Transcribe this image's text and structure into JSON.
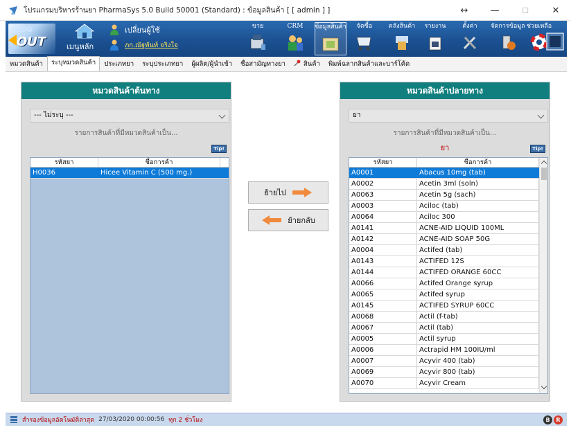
{
  "window": {
    "title": "โปรแกรมบริหารร้านยา PharmaSys 5.0 Build 50001 (Standard) : ข้อมูลสินค้า  [ [ admin ] ]",
    "minimize": "—",
    "restore": "☐",
    "close": "✕",
    "extra": "↔"
  },
  "toolbar": {
    "logout_top": "LOG",
    "logout_bottom": "OUT",
    "home_label": "เมนูหลัก",
    "change_user_label": "เปลี่ยนผู้ใช้",
    "user_name": "ภก.ณัฐพันท์ จริงใจ",
    "buttons": [
      {
        "label": "ขาย",
        "icon": "sale-icon"
      },
      {
        "label": "CRM",
        "icon": "crm-icon"
      },
      {
        "label": "ข้อมูลสินค้า",
        "icon": "product-data-icon",
        "active": true
      },
      {
        "label": "จัดซื้อ",
        "icon": "purchase-icon"
      },
      {
        "label": "คลังสินค้า",
        "icon": "warehouse-icon"
      },
      {
        "label": "รายงาน",
        "icon": "report-icon"
      },
      {
        "label": "ตั้งค่า",
        "icon": "settings-icon"
      },
      {
        "label": "จัดการข้อมูล",
        "icon": "data-management-icon"
      },
      {
        "label": "ช่วยเหลือ",
        "icon": "help-icon"
      },
      {
        "label": "",
        "icon": "exit-icon"
      }
    ]
  },
  "tabs": [
    {
      "label": "หมวดสินค้า"
    },
    {
      "label": "ระบุหมวดสินค้า",
      "active": true
    },
    {
      "label": "ประเภทยา"
    },
    {
      "label": "ระบุประเภทยา"
    },
    {
      "label": "ผู้ผลิต/ผู้นำเข้า"
    },
    {
      "label": "ชื่อสามัญทางยา"
    },
    {
      "label": "สินค้า",
      "pin": true
    },
    {
      "label": "พิมพ์ฉลากสินค้าและบาร์โค้ด"
    }
  ],
  "source": {
    "title": "หมวดสินค้าต้นทาง",
    "select_value": "--- ไม่ระบุ ---",
    "hint": "รายการสินค้าที่มีหมวดสินค้าเป็น...",
    "tip": "Tip!",
    "col_code": "รหัสยา",
    "col_name": "ชื่อการค้า",
    "rows": [
      {
        "code": "H0036",
        "name": "Hicee Vitamin C (500 mg.)",
        "selected": true
      }
    ]
  },
  "target": {
    "title": "หมวดสินค้าปลายทาง",
    "select_value": "ยา",
    "hint": "รายการสินค้าที่มีหมวดสินค้าเป็น...",
    "category_label": "ยา",
    "tip": "Tip!",
    "col_code": "รหัสยา",
    "col_name": "ชื่อการค้า",
    "rows": [
      {
        "code": "A0001",
        "name": "Abacus 10mg (tab)",
        "selected": true
      },
      {
        "code": "A0002",
        "name": "Acetin 3ml (soln)"
      },
      {
        "code": "A0063",
        "name": "Acetin 5g (sach)"
      },
      {
        "code": "A0003",
        "name": "Aciloc (tab)"
      },
      {
        "code": "A0064",
        "name": "Aciloc 300"
      },
      {
        "code": "A0141",
        "name": "ACNE-AID LIQUID 100ML"
      },
      {
        "code": "A0142",
        "name": "ACNE-AID SOAP 50G"
      },
      {
        "code": "A0004",
        "name": "Actifed (tab)"
      },
      {
        "code": "A0143",
        "name": "ACTIFED 12S"
      },
      {
        "code": "A0144",
        "name": "ACTIFED ORANGE 60CC"
      },
      {
        "code": "A0066",
        "name": "Actifed Orange syrup"
      },
      {
        "code": "A0065",
        "name": "Actifed syrup"
      },
      {
        "code": "A0145",
        "name": "ACTIFED SYRUP 60CC"
      },
      {
        "code": "A0068",
        "name": "Actil (f-tab)"
      },
      {
        "code": "A0067",
        "name": "Actil (tab)"
      },
      {
        "code": "A0005",
        "name": "Actil syrup"
      },
      {
        "code": "A0006",
        "name": "Actrapid HM 100IU/ml"
      },
      {
        "code": "A0007",
        "name": "Acyvir 400 (tab)"
      },
      {
        "code": "A0069",
        "name": "Acyvir 800 (tab)"
      },
      {
        "code": "A0070",
        "name": "Acyvir Cream"
      }
    ]
  },
  "actions": {
    "move_to": "ย้ายไป",
    "move_back": "ย้ายกลับ"
  },
  "status": {
    "backup_text": "สำรองข้อมูลอัตโนมัติล่าสุด",
    "datetime": "27/03/2020 00:00:56",
    "interval": "ทุก 2 ชั่วโมง",
    "circle1": "B",
    "circle2": "R"
  },
  "colors": {
    "header_teal": "#127f7f",
    "toolbar_blue": "#1a4f8f",
    "selection_blue": "#0f7bd8",
    "user_yellow": "#ffe65a",
    "accent_red": "#c20000"
  }
}
